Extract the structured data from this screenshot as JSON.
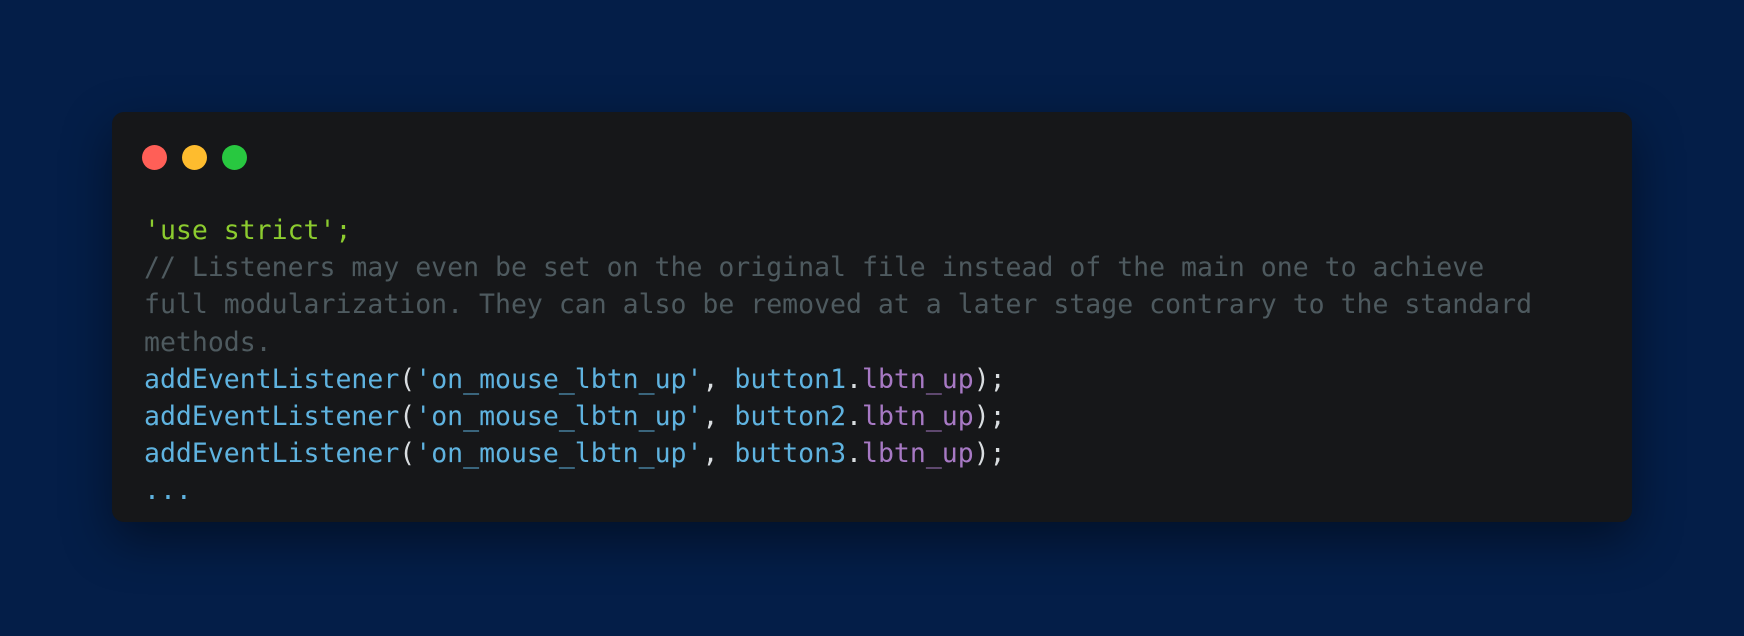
{
  "colors": {
    "background": "#041e48",
    "window": "#161719",
    "close": "#ff5f57",
    "minimize": "#febc2e",
    "maximize": "#28c840",
    "string_green": "#8ccc2f",
    "comment": "#4e5a5f",
    "function": "#5fb3e0",
    "punctuation": "#d9dde0",
    "property": "#a779c4"
  },
  "window_controls": [
    "close",
    "minimize",
    "maximize"
  ],
  "code_lines": [
    [
      {
        "text": "'use strict';",
        "color": "#8ccc2f"
      }
    ],
    [
      {
        "text": "// Listeners may even be set on the original file instead of the main one to achieve",
        "color": "#4e5a5f"
      }
    ],
    [
      {
        "text": "full modularization. They can also be removed at a later stage contrary to the standard",
        "color": "#4e5a5f"
      }
    ],
    [
      {
        "text": "methods.",
        "color": "#4e5a5f"
      }
    ],
    [
      {
        "text": "addEventListener",
        "color": "#5fb3e0"
      },
      {
        "text": "(",
        "color": "#d9dde0"
      },
      {
        "text": "'on_mouse_lbtn_up'",
        "color": "#5fb3e0"
      },
      {
        "text": ", ",
        "color": "#d9dde0"
      },
      {
        "text": "button1",
        "color": "#5fb3e0"
      },
      {
        "text": ".",
        "color": "#d9dde0"
      },
      {
        "text": "lbtn_up",
        "color": "#a779c4"
      },
      {
        "text": ");",
        "color": "#d9dde0"
      }
    ],
    [
      {
        "text": "addEventListener",
        "color": "#5fb3e0"
      },
      {
        "text": "(",
        "color": "#d9dde0"
      },
      {
        "text": "'on_mouse_lbtn_up'",
        "color": "#5fb3e0"
      },
      {
        "text": ", ",
        "color": "#d9dde0"
      },
      {
        "text": "button2",
        "color": "#5fb3e0"
      },
      {
        "text": ".",
        "color": "#d9dde0"
      },
      {
        "text": "lbtn_up",
        "color": "#a779c4"
      },
      {
        "text": ");",
        "color": "#d9dde0"
      }
    ],
    [
      {
        "text": "addEventListener",
        "color": "#5fb3e0"
      },
      {
        "text": "(",
        "color": "#d9dde0"
      },
      {
        "text": "'on_mouse_lbtn_up'",
        "color": "#5fb3e0"
      },
      {
        "text": ", ",
        "color": "#d9dde0"
      },
      {
        "text": "button3",
        "color": "#5fb3e0"
      },
      {
        "text": ".",
        "color": "#d9dde0"
      },
      {
        "text": "lbtn_up",
        "color": "#a779c4"
      },
      {
        "text": ");",
        "color": "#d9dde0"
      }
    ],
    [
      {
        "text": "...",
        "color": "#5fb3e0"
      }
    ]
  ]
}
